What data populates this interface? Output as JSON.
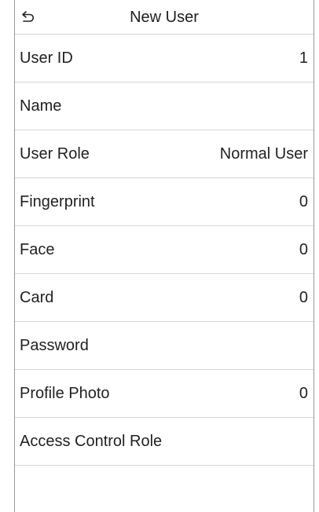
{
  "header": {
    "title": "New User",
    "back_icon": "back-arrow-icon"
  },
  "rows": [
    {
      "label": "User ID",
      "value": "1"
    },
    {
      "label": "Name",
      "value": ""
    },
    {
      "label": "User Role",
      "value": "Normal User"
    },
    {
      "label": "Fingerprint",
      "value": "0"
    },
    {
      "label": "Face",
      "value": "0"
    },
    {
      "label": "Card",
      "value": "0"
    },
    {
      "label": "Password",
      "value": ""
    },
    {
      "label": "Profile Photo",
      "value": "0"
    },
    {
      "label": "Access Control Role",
      "value": ""
    }
  ],
  "colors": {
    "divider": "#d6d6d6",
    "frame": "#9a9a9a",
    "text": "#222222"
  }
}
